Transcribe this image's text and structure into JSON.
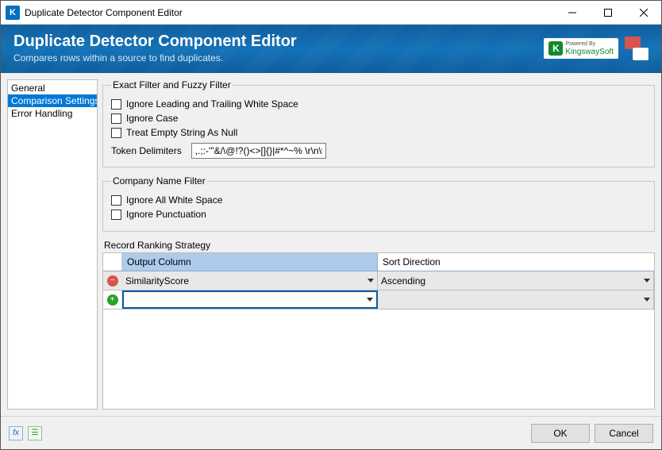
{
  "window": {
    "title": "Duplicate Detector Component Editor"
  },
  "header": {
    "title": "Duplicate Detector Component Editor",
    "subtitle": "Compares rows within a source to find duplicates.",
    "logo_powered": "Powered By",
    "logo_name": "KingswaySoft"
  },
  "sidebar": {
    "items": [
      {
        "label": "General",
        "selected": false
      },
      {
        "label": "Comparison Settings",
        "selected": true
      },
      {
        "label": "Error Handling",
        "selected": false
      }
    ]
  },
  "exactFuzzy": {
    "legend": "Exact Filter and Fuzzy Filter",
    "ignore_ws": "Ignore Leading and Trailing White Space",
    "ignore_case": "Ignore Case",
    "treat_null": "Treat Empty String As Null",
    "token_label": "Token Delimiters",
    "token_value": ",.;:-'\"&/\\@!?()<>[]{}|#*^~% \\r\\n\\t"
  },
  "companyFilter": {
    "legend": "Company Name Filter",
    "ignore_all_ws": "Ignore All White Space",
    "ignore_punct": "Ignore Punctuation"
  },
  "ranking": {
    "label": "Record Ranking Strategy",
    "col_output": "Output Column",
    "col_sort": "Sort Direction",
    "rows": [
      {
        "output": "SimilarityScore",
        "sort": "Ascending"
      },
      {
        "output": "",
        "sort": ""
      }
    ]
  },
  "footer": {
    "ok": "OK",
    "cancel": "Cancel"
  }
}
